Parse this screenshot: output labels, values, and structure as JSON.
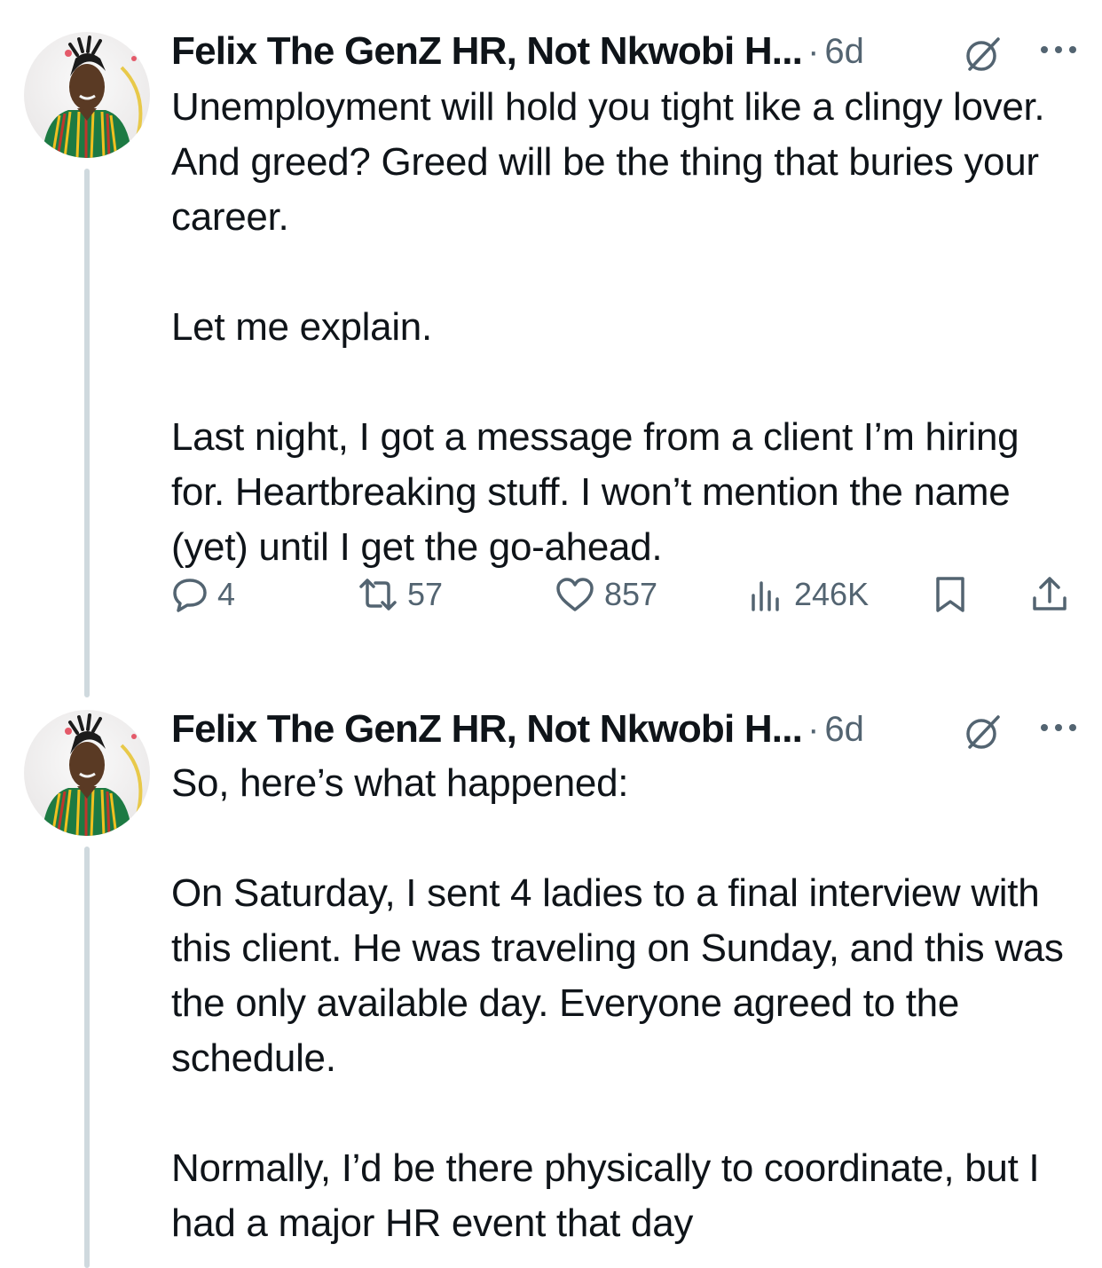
{
  "tweets": [
    {
      "author": "Felix The GenZ HR, Not Nkwobi H...",
      "separator": "·",
      "time": "6d",
      "text": "Unemployment will hold you tight like a clingy lover. And greed? Greed will be the thing that buries your career.\n\nLet me explain.\n\nLast night, I got a message from a client I’m hiring for. Heartbreaking stuff. I won’t mention the name (yet) until I get the go-ahead.",
      "replies": "4",
      "reposts": "57",
      "likes": "857",
      "views": "246K"
    },
    {
      "author": "Felix The GenZ HR, Not Nkwobi H...",
      "separator": "·",
      "time": "6d",
      "text": "So, here’s what happened:\n\nOn Saturday, I sent 4 ladies to a final interview with this client. He was traveling on Sunday, and this was the only available day. Everyone agreed to the schedule.\n\nNormally, I’d be there physically to coordinate, but I had a major HR event that day"
    }
  ],
  "icons": {
    "grok": "grok-icon",
    "more": "more-icon",
    "reply": "reply-icon",
    "repost": "repost-icon",
    "like": "like-icon",
    "views": "views-icon",
    "bookmark": "bookmark-icon",
    "share": "share-icon"
  },
  "colors": {
    "text": "#0f1419",
    "secondary": "#536471",
    "thread_line": "#cfd9de"
  }
}
